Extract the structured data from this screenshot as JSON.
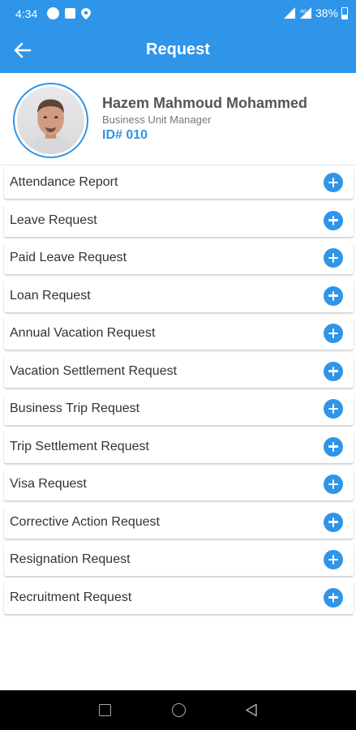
{
  "status_bar": {
    "time": "4:34",
    "battery": "38%",
    "network": "4G"
  },
  "app_bar": {
    "title": "Request"
  },
  "profile": {
    "name": "Hazem Mahmoud Mohammed",
    "role": "Business Unit Manager",
    "id": "ID# 010"
  },
  "requests": [
    {
      "label": "Attendance Report"
    },
    {
      "label": "Leave Request"
    },
    {
      "label": "Paid Leave Request"
    },
    {
      "label": "Loan Request"
    },
    {
      "label": "Annual Vacation Request"
    },
    {
      "label": "Vacation Settlement Request"
    },
    {
      "label": "Business Trip Request"
    },
    {
      "label": "Trip Settlement Request"
    },
    {
      "label": "Visa Request"
    },
    {
      "label": "Corrective Action Request"
    },
    {
      "label": "Resignation Request"
    },
    {
      "label": "Recruitment Request"
    }
  ],
  "colors": {
    "primary": "#2f95e8",
    "nav_bar": "#000000"
  }
}
